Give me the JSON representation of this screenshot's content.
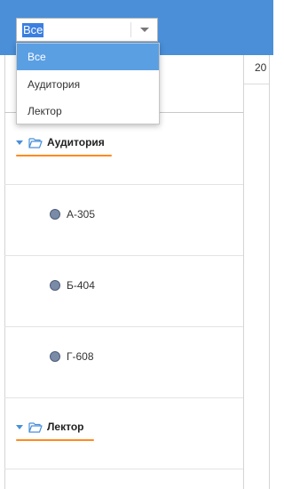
{
  "filter": {
    "value": "Все",
    "options": [
      {
        "label": "Все",
        "selected": true
      },
      {
        "label": "Аудитория",
        "selected": false
      },
      {
        "label": "Лектор",
        "selected": false
      }
    ]
  },
  "schedule": {
    "date_header_partial": "20"
  },
  "tree": {
    "groups": [
      {
        "label": "Аудитория",
        "expanded": true,
        "items": [
          {
            "label": "А-305"
          },
          {
            "label": "Б-404"
          },
          {
            "label": "Г-608"
          }
        ]
      },
      {
        "label": "Лектор",
        "expanded": true,
        "items": []
      }
    ]
  },
  "colors": {
    "header_bg": "#4a8fd8",
    "selection": "#5b9fe3",
    "highlight_underline": "#ff8a1e",
    "resource_dot": "#7a8ba8"
  }
}
